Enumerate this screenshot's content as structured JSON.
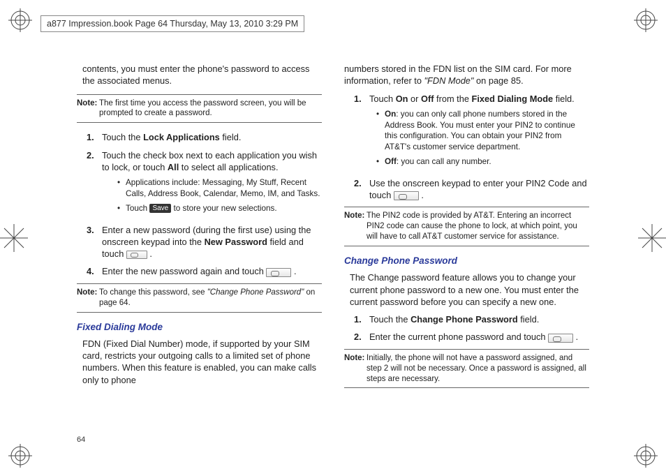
{
  "header": {
    "text": "a877 Impression.book  Page 64  Thursday, May 13, 2010  3:29 PM"
  },
  "page_number": "64",
  "left": {
    "intro": "contents, you must enter the phone's password to access the associated menus.",
    "note1_label": "Note:",
    "note1": "The first time you access the password screen, you will be prompted to create a password.",
    "step1_pre": "Touch the ",
    "step1_bold": "Lock Applications",
    "step1_post": " field.",
    "step2_pre": "Touch the check box next to each application you wish to lock, or touch ",
    "step2_bold": "All",
    "step2_post": " to select all applications.",
    "bullet1": "Applications include: Messaging, My Stuff, Recent Calls, Address Book, Calendar, Memo, IM, and Tasks.",
    "bullet2_pre": "Touch ",
    "bullet2_btn": "Save",
    "bullet2_post": " to store your new selections.",
    "step3_pre": "Enter a new password (during the first use) using the onscreen keypad into the ",
    "step3_bold": "New Password",
    "step3_post": " field and touch ",
    "step4_pre": "Enter the new password again and touch ",
    "note2_label": "Note:",
    "note2_pre": "To change this password, see ",
    "note2_ital": "\"Change Phone Password\"",
    "note2_post": " on page 64.",
    "heading_fdn": "Fixed Dialing Mode",
    "fdn_para": "FDN (Fixed Dial Number) mode, if supported by your SIM card, restricts your outgoing calls to a limited set of phone numbers. When this feature is enabled, you can make calls only to phone"
  },
  "right": {
    "cont_pre": "numbers stored in the FDN list on the SIM card. For more information, refer to ",
    "cont_ital": "\"FDN Mode\" ",
    "cont_post": " on page 85.",
    "step1_pre": "Touch ",
    "step1_b1": "On",
    "step1_mid1": " or ",
    "step1_b2": "Off",
    "step1_mid2": " from the ",
    "step1_b3": "Fixed Dialing Mode",
    "step1_post": " field.",
    "bullet_on_b": "On",
    "bullet_on": ": you can only call phone numbers stored in the Address Book. You must enter your PIN2 to continue this configuration. You can obtain your PIN2 from AT&T's customer service department.",
    "bullet_off_b": "Off",
    "bullet_off": ": you can call any number.",
    "step2": "Use the onscreen keypad to enter your PIN2 Code and touch ",
    "note1_label": "Note:",
    "note1": "The PIN2 code is provided by AT&T. Entering an incorrect PIN2 code can cause the phone to lock, at which point, you will have to call AT&T customer service for assistance.",
    "heading_cpp": "Change Phone Password",
    "cpp_para": "The Change password feature allows you to change your current phone password to a new one. You must enter the current password before you can specify a new one.",
    "cpp_s1_pre": "Touch the ",
    "cpp_s1_b": "Change Phone Password",
    "cpp_s1_post": " field.",
    "cpp_s2": "Enter the current phone password and touch ",
    "note2_label": "Note:",
    "note2": "Initially, the phone will not have a password assigned, and step 2 will not be necessary. Once a password is assigned, all steps are necessary."
  }
}
